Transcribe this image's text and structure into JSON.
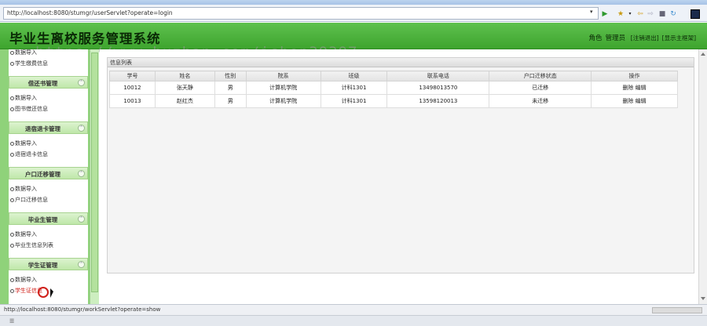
{
  "browser": {
    "url": "http://localhost:8080/stumgr/userServlet?operate=login",
    "status_url": "http://localhost:8080/stumgr/workServlet?operate=show",
    "icons": [
      "dropdown-arrow-icon",
      "go-icon",
      "bookmark-icon",
      "back-icon",
      "forward-icon",
      "stop-icon",
      "refresh-icon",
      "menu-icon"
    ]
  },
  "header": {
    "title": "毕业生离校服务管理系统",
    "role_label": "角色",
    "role_value": "管理员",
    "logout_label": "[注销退出]",
    "toggle_label": "[显示主框架]"
  },
  "watermark": "https://www.huzhan.com/ishop39397",
  "sidebar": {
    "partial_items": [
      "数据导入",
      "学生缴费信息"
    ],
    "sections": [
      {
        "title": "借还书管理",
        "items": [
          "数据导入",
          "图书借还信息"
        ]
      },
      {
        "title": "退宿退卡管理",
        "items": [
          "数据导入",
          "退宿退卡信息"
        ]
      },
      {
        "title": "户口迁移管理",
        "items": [
          "数据导入",
          "户口迁移信息"
        ]
      },
      {
        "title": "毕业生管理",
        "items": [
          "数据导入",
          "毕业生信息列表"
        ]
      },
      {
        "title": "学生证管理",
        "items": [
          "数据导入",
          "学生证信息"
        ]
      }
    ]
  },
  "panel": {
    "title": "信息列表",
    "columns": [
      "学号",
      "姓名",
      "性别",
      "院系",
      "班级",
      "联系电话",
      "户口迁移状态",
      "操作"
    ],
    "rows": [
      {
        "id": "10012",
        "name": "张天静",
        "gender": "男",
        "dept": "计算机学院",
        "class": "计科1301",
        "phone": "13498013570",
        "status": "已迁移",
        "delete": "删除",
        "edit": "编辑"
      },
      {
        "id": "10013",
        "name": "赵红杰",
        "gender": "男",
        "dept": "计算机学院",
        "class": "计科1301",
        "phone": "13598120013",
        "status": "未迁移",
        "delete": "删除",
        "edit": "编辑"
      }
    ]
  },
  "colors": {
    "header_green": "#4db33d",
    "sidebar_green": "#8fd27a",
    "active_link": "#d0201a"
  }
}
